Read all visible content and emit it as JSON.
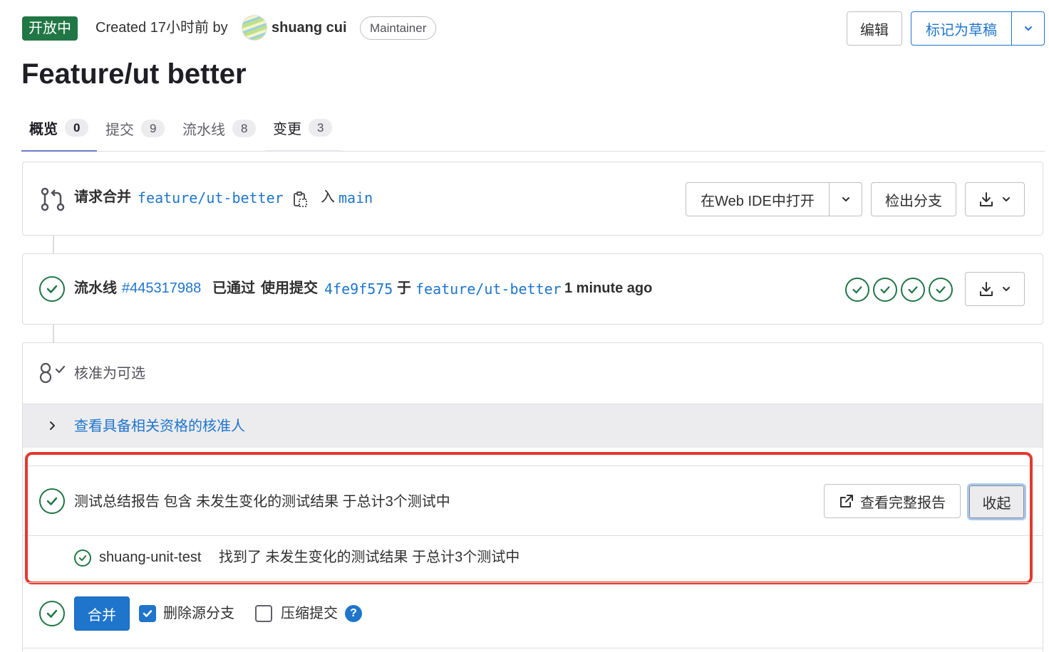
{
  "header": {
    "status": "开放中",
    "created_text": "Created 17小时前 by",
    "author": "shuang cui",
    "role": "Maintainer",
    "edit_label": "编辑",
    "draft_label": "标记为草稿"
  },
  "title": "Feature/ut better",
  "tabs": [
    {
      "label": "概览",
      "count": "0"
    },
    {
      "label": "提交",
      "count": "9"
    },
    {
      "label": "流水线",
      "count": "8"
    },
    {
      "label": "变更",
      "count": "3"
    }
  ],
  "merge_request": {
    "prefix": "请求合并",
    "source_branch": "feature/ut-better",
    "into": "入",
    "target_branch": "main",
    "open_ide_label": "在Web IDE中打开",
    "checkout_label": "检出分支"
  },
  "pipeline": {
    "prefix": "流水线",
    "id": "#445317988",
    "status": "已通过",
    "using_commit": "使用提交",
    "commit": "4fe9f575",
    "on": "于",
    "branch": "feature/ut-better",
    "time": "1 minute ago",
    "stage_count": 4
  },
  "approvals": {
    "text": "核准为可选",
    "view_eligible": "查看具备相关资格的核准人"
  },
  "test_summary": {
    "text": "测试总结报告 包含 未发生变化的测试结果 于总计3个测试中",
    "full_report_label": "查看完整报告",
    "collapse_label": "收起",
    "suite_name": "shuang-unit-test",
    "suite_text": "找到了 未发生变化的测试结果 于总计3个测试中"
  },
  "merge": {
    "merge_label": "合并",
    "delete_source_label": "删除源分支",
    "delete_source_checked": true,
    "squash_label": "压缩提交",
    "squash_checked": false,
    "help": "?"
  },
  "colors": {
    "success": "#217645",
    "link": "#1f75cb",
    "highlight": "#e3392f"
  }
}
